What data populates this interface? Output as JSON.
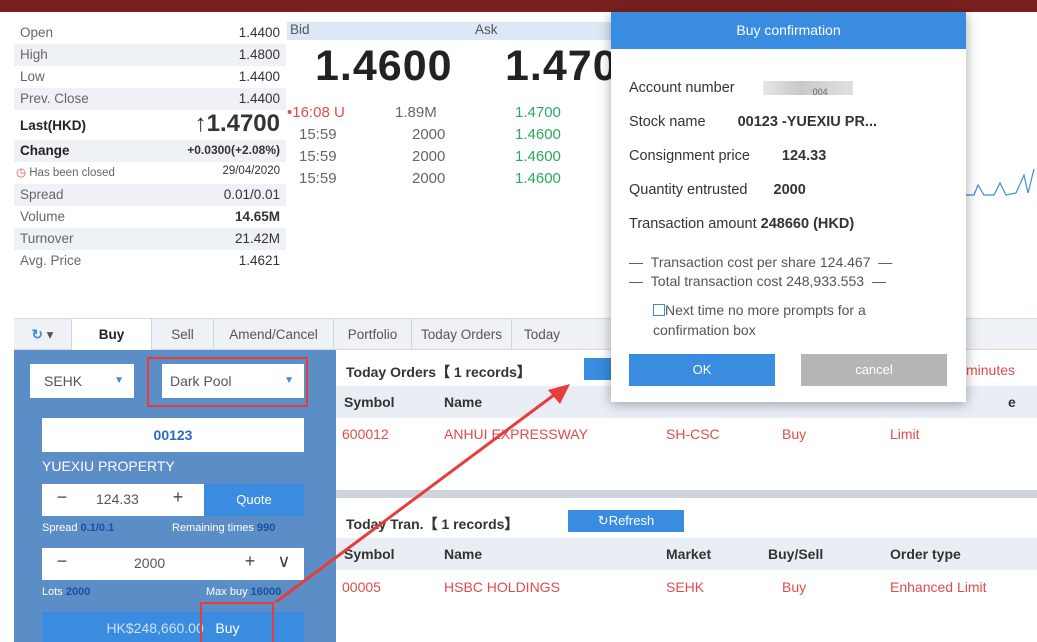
{
  "quote": {
    "rows": [
      {
        "label": "Open",
        "value": "1.4400"
      },
      {
        "label": "High",
        "value": "1.4800"
      },
      {
        "label": "Low",
        "value": "1.4400"
      },
      {
        "label": "Prev. Close",
        "value": "1.4400"
      },
      {
        "label": "Last(HKD)",
        "value": "↑1.4700"
      },
      {
        "label": "Change",
        "value": "+0.0300(+2.08%)"
      },
      {
        "label": "Has been closed",
        "value": "29/04/2020"
      },
      {
        "label": "Spread",
        "value": "0.01/0.01"
      },
      {
        "label": "Volume",
        "value": "14.65M"
      },
      {
        "label": "Turnover",
        "value": "21.42M"
      },
      {
        "label": "Avg. Price",
        "value": "1.4621"
      }
    ]
  },
  "bidask": {
    "bid_label": "Bid",
    "ask_label": "Ask",
    "bid_value": "1.4600",
    "ask_value": "1.470"
  },
  "trades": [
    {
      "time": "•16:08 U",
      "vol": "1.89M",
      "price": "1.4700"
    },
    {
      "time": "15:59",
      "vol": "2000",
      "price": "1.4600"
    },
    {
      "time": "15:59",
      "vol": "2000",
      "price": "1.4600"
    },
    {
      "time": "15:59",
      "vol": "2000",
      "price": "1.4600"
    }
  ],
  "tabs": [
    "Buy",
    "Sell",
    "Amend/Cancel",
    "Portfolio",
    "Today Orders",
    "Today"
  ],
  "order_form": {
    "market": "SEHK",
    "pool": "Dark Pool",
    "code": "00123",
    "stock_name": "YUEXIU PROPERTY",
    "price": "124.33",
    "quote_btn": "Quote",
    "spread_label": "Spread",
    "spread_value": "0.1/0.1",
    "remaining_label": "Remaining times",
    "remaining_value": "990",
    "quantity": "2000",
    "lots_label": "Lots",
    "lots_value": "2000",
    "maxbuy_label": "Max buy",
    "maxbuy_value": "16000",
    "buy_amount": "HK$248,660.00",
    "buy_btn": "Buy",
    "minus": "−",
    "plus": "+",
    "chevron": "∨"
  },
  "today_orders": {
    "title": "Today Orders【 1 records】",
    "right_text": "minutes",
    "columns": [
      "Symbol",
      "Name",
      "",
      "",
      "e"
    ],
    "rows": [
      {
        "symbol": "600012",
        "name": "ANHUI EXPRESSWAY",
        "market": "SH-CSC",
        "side": "Buy",
        "type": "Limit"
      }
    ]
  },
  "today_tran": {
    "title": "Today Tran.【 1 records】",
    "refresh": "Refresh",
    "columns": [
      "Symbol",
      "Name",
      "Market",
      "Buy/Sell",
      "Order type"
    ],
    "rows": [
      {
        "symbol": "00005",
        "name": "HSBC HOLDINGS",
        "market": "SEHK",
        "side": "Buy",
        "type": "Enhanced Limit"
      }
    ]
  },
  "modal": {
    "title": "Buy confirmation",
    "account_label": "Account number",
    "account_value": "004",
    "stock_label": "Stock name",
    "stock_value": "00123 -YUEXIU PR...",
    "price_label": "Consignment price",
    "price_value": "124.33",
    "qty_label": "Quantity entrusted",
    "qty_value": "2000",
    "amount_label": "Transaction amount",
    "amount_value": "248660 (HKD)",
    "cost_per_share": "Transaction cost per share 124.467",
    "total_cost": "Total transaction cost 248,933.553",
    "checkbox_label": "Next time no more prompts for a confirmation box",
    "ok": "OK",
    "cancel": "cancel"
  },
  "colors": {
    "accent": "#3a8ce0",
    "up": "#2ca860",
    "down": "#e24b4b",
    "panel": "#5b8ec7",
    "annotation": "#e83b3b"
  }
}
